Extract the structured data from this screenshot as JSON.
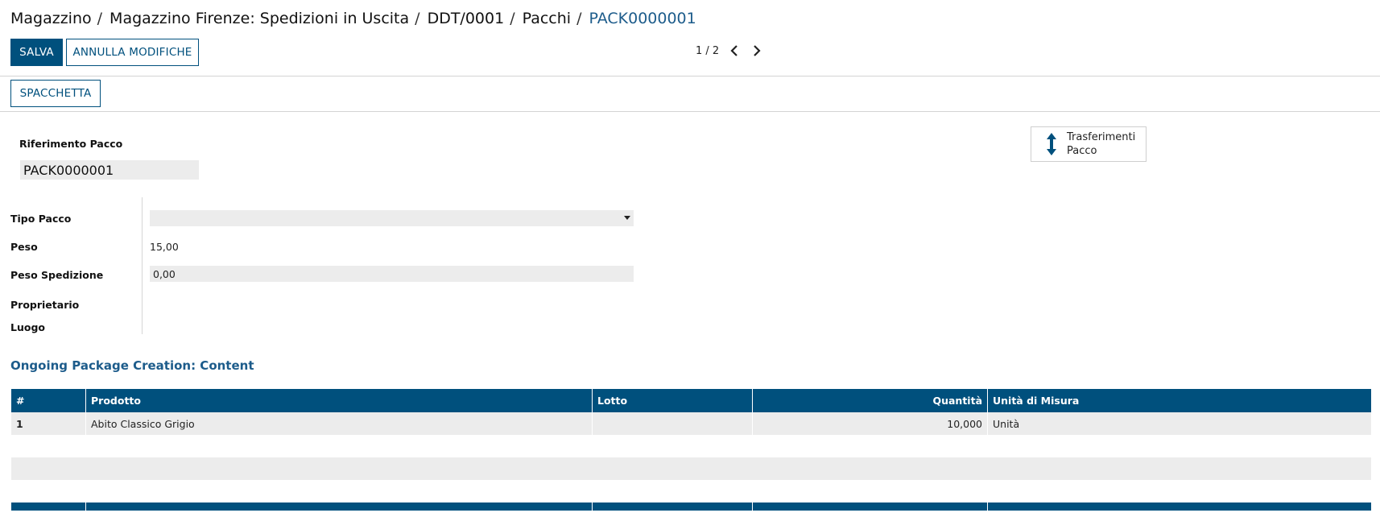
{
  "breadcrumb": {
    "items": [
      "Magazzino",
      "Magazzino Firenze: Spedizioni in Uscita",
      "DDT/0001",
      "Pacchi"
    ],
    "current": "PACK0000001",
    "separator": "/"
  },
  "toolbar": {
    "save_label": "SALVA",
    "discard_label": "ANNULLA MODIFICHE"
  },
  "pager": {
    "value": "1 / 2"
  },
  "statusbar": {
    "unpack_label": "SPACCHETTA"
  },
  "form": {
    "name_label": "Riferimento Pacco",
    "name_value": "PACK0000001",
    "smart_button": {
      "line1": "Trasferimenti",
      "line2": "Pacco",
      "icon": "arrows-v-icon"
    },
    "fields": {
      "package_type": {
        "label": "Tipo Pacco",
        "value": ""
      },
      "weight": {
        "label": "Peso",
        "value": "15,00"
      },
      "shipping_weight": {
        "label": "Peso Spedizione",
        "value": "0,00"
      },
      "owner": {
        "label": "Proprietario",
        "value": ""
      },
      "location": {
        "label": "Luogo",
        "value": ""
      }
    }
  },
  "content": {
    "title": "Ongoing Package Creation: Content",
    "columns": [
      "#",
      "Prodotto",
      "Lotto",
      "Quantità",
      "Unità di Misura"
    ],
    "rows": [
      {
        "num": "1",
        "product": "Abito Classico Grigio",
        "lot": "",
        "qty": "10,000",
        "uom": "Unità"
      }
    ]
  },
  "colors": {
    "primary": "#00507d",
    "link": "#1d5c8b",
    "field_bg": "#ececec"
  }
}
